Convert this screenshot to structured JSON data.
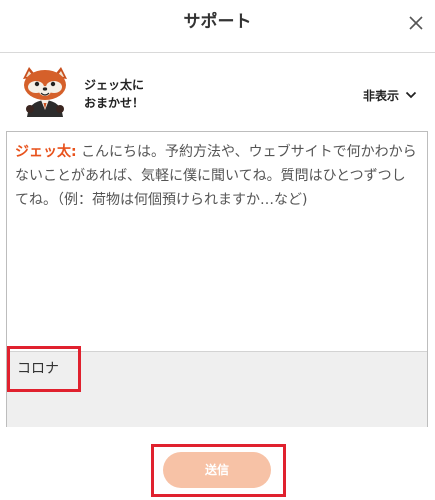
{
  "header": {
    "title": "サポート",
    "close_icon": "close-icon"
  },
  "agent": {
    "name": "ジェッ太に\nおまかせ！",
    "avatar_icon": "red-panda-mascot",
    "toggle_label": "非表示",
    "toggle_icon": "chevron-down-icon"
  },
  "chat": {
    "speaker": "ジェッ太:",
    "message": "こんにちは。予約方法や、ウェブサイトで何かわからないことがあれば、気軽に僕に聞いてね。質問はひとつずつしてね。（例：荷物は何個預けられますか…など)"
  },
  "input": {
    "value": "コロナ"
  },
  "send": {
    "label": "送信"
  },
  "colors": {
    "speaker": "#e8521c",
    "send_button": "#f7c2a6",
    "highlight": "#e0212e"
  }
}
